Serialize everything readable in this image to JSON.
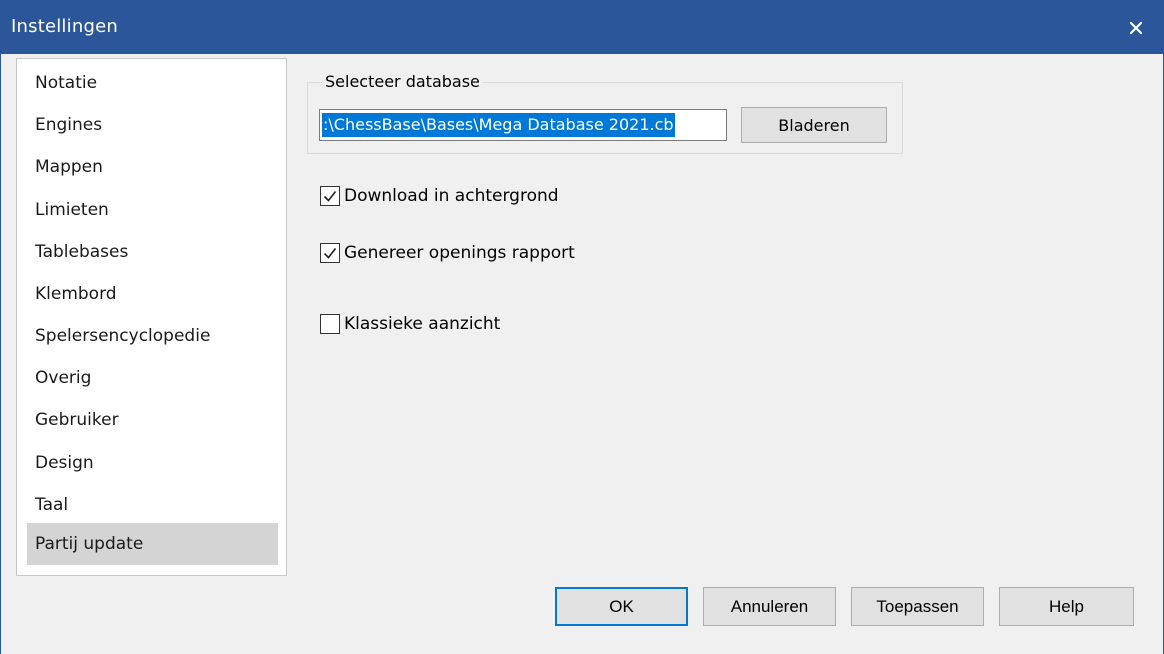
{
  "window": {
    "title": "Instellingen",
    "close_glyph": "✕"
  },
  "sidebar": {
    "items": [
      {
        "label": "Notatie"
      },
      {
        "label": "Engines"
      },
      {
        "label": "Mappen"
      },
      {
        "label": "Limieten"
      },
      {
        "label": "Tablebases"
      },
      {
        "label": "Klembord"
      },
      {
        "label": "Spelersencyclopedie"
      },
      {
        "label": "Overig"
      },
      {
        "label": "Gebruiker"
      },
      {
        "label": "Design"
      },
      {
        "label": "Taal"
      },
      {
        "label": "Partij update"
      }
    ],
    "selected": "Partij update"
  },
  "database": {
    "group_label": "Selecteer database",
    "path_value": ":\\ChessBase\\Bases\\Mega Database 2021.cb",
    "browse_label": "Bladeren"
  },
  "options": [
    {
      "label": "Download in achtergrond",
      "checked": true
    },
    {
      "label": "Genereer openings rapport",
      "checked": true
    },
    {
      "label": "Klassieke aanzicht",
      "checked": false
    }
  ],
  "buttons": {
    "ok": "OK",
    "cancel": "Annuleren",
    "apply": "Toepassen",
    "help": "Help"
  },
  "colors": {
    "titlebar": "#2b579a",
    "selection": "#0078d7",
    "nav_selected": "#d4d4d4"
  }
}
